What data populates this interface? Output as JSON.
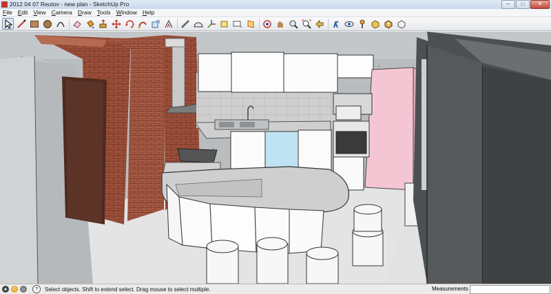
{
  "window": {
    "title": "2012 04 07 Reutov - new plan - SketchUp Pro",
    "controls": {
      "minimize": "–",
      "maximize": "□",
      "close": "✕"
    }
  },
  "menu": {
    "items": [
      "File",
      "Edit",
      "View",
      "Camera",
      "Draw",
      "Tools",
      "Window",
      "Help"
    ]
  },
  "toolbar": {
    "tools": [
      "select-tool",
      "line-tool",
      "rectangle-tool",
      "circle-tool",
      "arc-tool",
      "eraser-tool",
      "paint-bucket-tool",
      "push-pull-tool",
      "move-tool",
      "rotate-tool",
      "follow-me-tool",
      "scale-tool",
      "offset-tool",
      "tape-measure-tool",
      "protractor-tool",
      "axes-tool",
      "dimension-tool",
      "text-tool",
      "section-plane-tool",
      "orbit-tool",
      "pan-tool",
      "zoom-tool",
      "zoom-extents-tool",
      "previous-view-tool",
      "walk-tool",
      "look-around-tool",
      "position-camera-tool",
      "get-models-tool",
      "share-model-tool",
      "components-tool"
    ]
  },
  "status": {
    "hint": "Select objects. Shift to extend select. Drag mouse to select multiple.",
    "measurements_label": "Measurements",
    "measurements_value": ""
  },
  "colors": {
    "accent": "#c0392b",
    "brick": "#a0553f",
    "pink_fridge": "#f4c6d3",
    "glass_blue": "#bfe3f2"
  }
}
